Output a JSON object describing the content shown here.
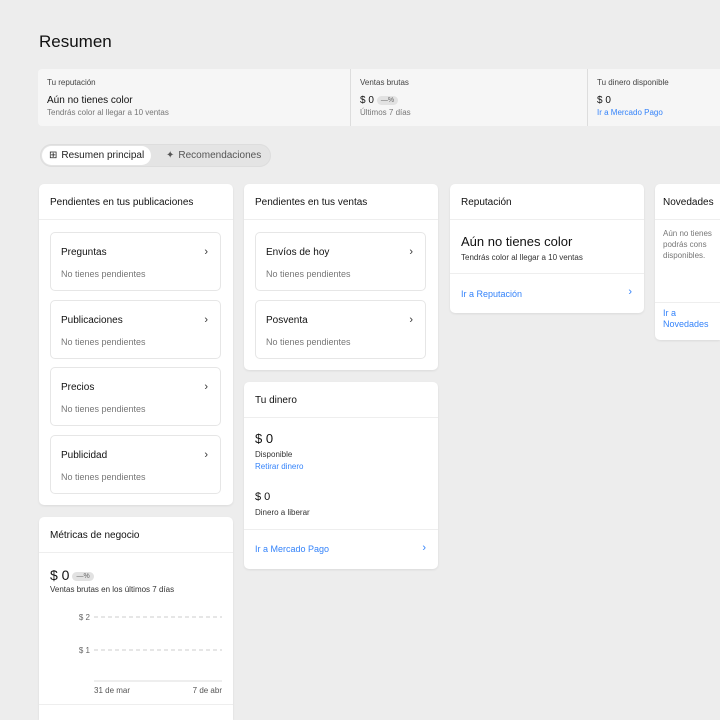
{
  "page_title": "Resumen",
  "summary": {
    "reputation": {
      "label": "Tu reputación",
      "value": "Aún no tienes color",
      "sub": "Tendrás color al llegar a 10 ventas"
    },
    "sales": {
      "label": "Ventas brutas",
      "value": "$ 0",
      "badge": "—%",
      "sub": "Últimos 7 días"
    },
    "money": {
      "label": "Tu dinero disponible",
      "value": "$ 0",
      "link": "Ir a Mercado Pago"
    }
  },
  "tabs": [
    {
      "label": "Resumen principal",
      "active": true
    },
    {
      "label": "Recomendaciones",
      "active": false
    }
  ],
  "publications": {
    "title": "Pendientes en tus publicaciones",
    "items": [
      {
        "title": "Preguntas",
        "sub": "No tienes pendientes"
      },
      {
        "title": "Publicaciones",
        "sub": "No tienes pendientes"
      },
      {
        "title": "Precios",
        "sub": "No tienes pendientes"
      },
      {
        "title": "Publicidad",
        "sub": "No tienes pendientes"
      }
    ]
  },
  "sales_pending": {
    "title": "Pendientes en tus ventas",
    "items": [
      {
        "title": "Envíos de hoy",
        "sub": "No tienes pendientes"
      },
      {
        "title": "Posventa",
        "sub": "No tienes pendientes"
      }
    ]
  },
  "money": {
    "title": "Tu dinero",
    "available": "$ 0",
    "available_label": "Disponible",
    "withdraw": "Retirar dinero",
    "to_release": "$ 0",
    "to_release_label": "Dinero a liberar",
    "link": "Ir a Mercado Pago"
  },
  "reputation": {
    "title": "Reputación",
    "value": "Aún no tienes color",
    "sub": "Tendrás color al llegar a 10 ventas",
    "link": "Ir a Reputación"
  },
  "news": {
    "title": "Novedades",
    "text1": "Aún no tienes",
    "text2": "podrás cons",
    "text3": "disponibles.",
    "link": "Ir a Novedades"
  },
  "metrics": {
    "title": "Métricas de negocio",
    "value": "$ 0",
    "badge": "—%",
    "sub": "Ventas brutas en los últimos 7 días",
    "chart_data": {
      "type": "line",
      "y_ticks": [
        "$ 2",
        "$ 1"
      ],
      "x_ticks": [
        "31 de mar",
        "7 de abr"
      ],
      "ylim": [
        0,
        2
      ],
      "series": []
    }
  }
}
